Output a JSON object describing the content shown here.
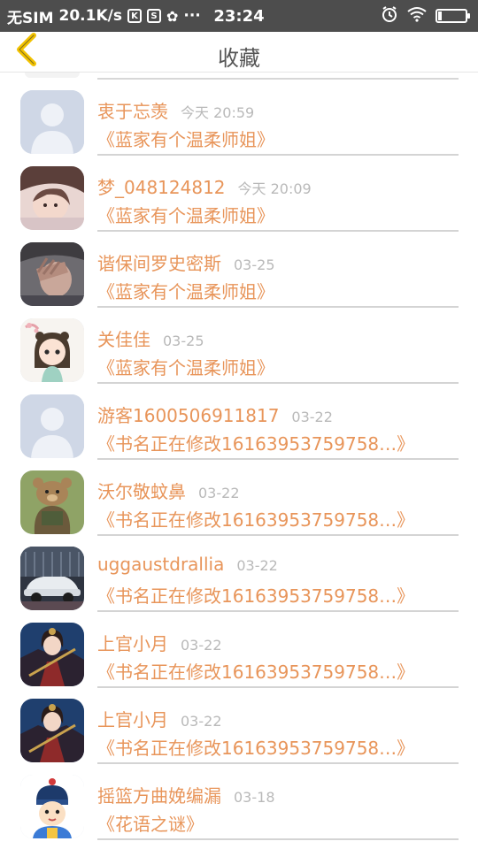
{
  "status_bar": {
    "carrier": "无SIM",
    "speed": "20.1K/s",
    "time": "23:24",
    "dots": "···"
  },
  "header": {
    "title": "收藏",
    "back_icon": "chevron-left-icon",
    "accent_color": "#f2c200"
  },
  "items": [
    {
      "name": "衷于忘羡",
      "time": "今天 20:59",
      "book": "《蓝家有个温柔师姐》",
      "avatar": "default"
    },
    {
      "name": "梦_048124812",
      "time": "今天 20:09",
      "book": "《蓝家有个温柔师姐》",
      "avatar": "photo-girl"
    },
    {
      "name": "谐保间罗史密斯",
      "time": "03-25",
      "book": "《蓝家有个温柔师姐》",
      "avatar": "photo-hand"
    },
    {
      "name": "关佳佳",
      "time": "03-25",
      "book": "《蓝家有个温柔师姐》",
      "avatar": "cartoon-girl"
    },
    {
      "name": "游客1600506911817",
      "time": "03-22",
      "book": "《书名正在修改16163953759758…》",
      "avatar": "default"
    },
    {
      "name": "沃尔敬蚊鼻",
      "time": "03-22",
      "book": "《书名正在修改16163953759758…》",
      "avatar": "cartoon-bear"
    },
    {
      "name": "uggaustdrallia",
      "time": "03-22",
      "book": "《书名正在修改16163953759758…》",
      "avatar": "photo-car"
    },
    {
      "name": "上官小月",
      "time": "03-22",
      "book": "《书名正在修改16163953759758…》",
      "avatar": "anime-warrior"
    },
    {
      "name": "上官小月",
      "time": "03-22",
      "book": "《书名正在修改16163953759758…》",
      "avatar": "anime-warrior"
    },
    {
      "name": "摇篮方曲娩编漏",
      "time": "03-18",
      "book": "《花语之谜》",
      "avatar": "cartoon-boy"
    }
  ]
}
